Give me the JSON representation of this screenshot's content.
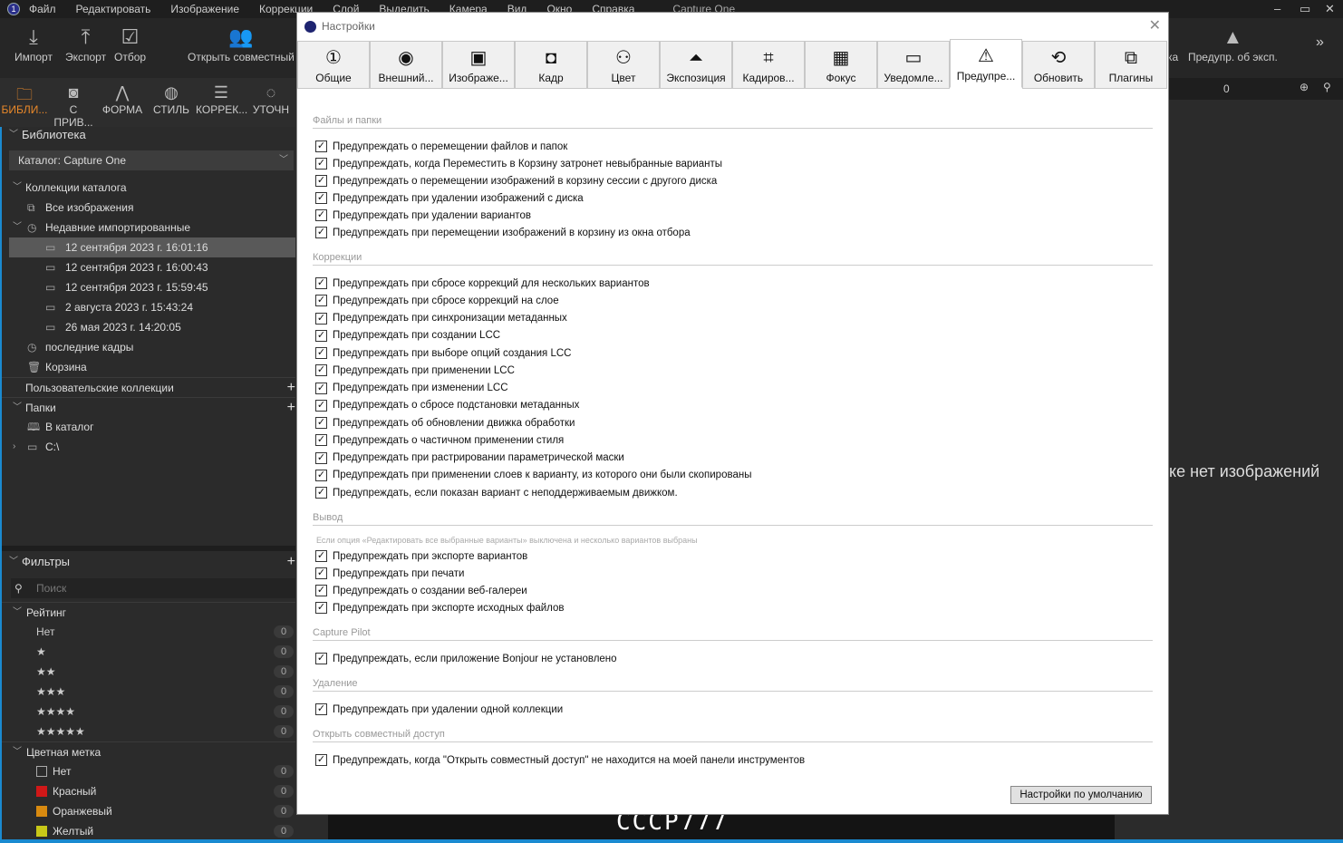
{
  "menu": {
    "items": [
      "Файл",
      "Редактировать",
      "Изображение",
      "Коррекции",
      "Слой",
      "Выделить",
      "Камера",
      "Вид",
      "Окно",
      "Справка"
    ],
    "app_title": "Capture One"
  },
  "toolbar": {
    "import": "Импорт",
    "export": "Экспорт",
    "select": "Отбор",
    "share": "Открыть совместный",
    "warn_partial": "ка",
    "exposure_warning": "Предупр. об эксп.",
    "counter": "0"
  },
  "tooltabs": [
    "БИБЛИ...",
    "С ПРИВ...",
    "ФОРМА",
    "СТИЛЬ",
    "КОРРЕК...",
    "УТОЧН"
  ],
  "library": {
    "title": "Библиотека",
    "catalog": "Каталог: Capture One",
    "collections": "Коллекции каталога",
    "all_images": "Все изображения",
    "recent_imports": "Недавние импортированные",
    "imports": [
      "12 сентября 2023 г. 16:01:16",
      "12 сентября 2023 г. 16:00:43",
      "12 сентября 2023 г. 15:59:45",
      "2 августа 2023 г. 15:43:24",
      "26 мая 2023 г. 14:20:05"
    ],
    "recent_captures": "последние кадры",
    "trash": "Корзина",
    "user_collections": "Пользовательские коллекции",
    "folders": "Папки",
    "in_catalog": "В каталог",
    "drive": "C:\\"
  },
  "filters": {
    "title": "Фильтры",
    "search_placeholder": "Поиск",
    "rating": "Рейтинг",
    "rating_rows": [
      {
        "label": "Нет",
        "count": "0"
      },
      {
        "label": "★",
        "count": "0"
      },
      {
        "label": "★★",
        "count": "0"
      },
      {
        "label": "★★★",
        "count": "0"
      },
      {
        "label": "★★★★",
        "count": "0"
      },
      {
        "label": "★★★★★",
        "count": "0"
      }
    ],
    "color_label": "Цветная метка",
    "colors": [
      {
        "label": "Нет",
        "count": "0",
        "color": "transparent"
      },
      {
        "label": "Красный",
        "count": "0",
        "color": "#d01818"
      },
      {
        "label": "Оранжевый",
        "count": "0",
        "color": "#d88a10"
      },
      {
        "label": "Желтый",
        "count": "0",
        "color": "#c8c818"
      }
    ]
  },
  "viewer": {
    "empty_text": "ке нет изображений",
    "logo": "CCCP777"
  },
  "dialog": {
    "title": "Настройки",
    "tabs": [
      {
        "label": "Общие",
        "icon": "①"
      },
      {
        "label": "Внешний...",
        "icon": "◉"
      },
      {
        "label": "Изображе...",
        "icon": "▣"
      },
      {
        "label": "Кадр",
        "icon": "◘"
      },
      {
        "label": "Цвет",
        "icon": "⚇"
      },
      {
        "label": "Экспозиция",
        "icon": "⏶"
      },
      {
        "label": "Кадиров...",
        "icon": "⌗"
      },
      {
        "label": "Фокус",
        "icon": "▦"
      },
      {
        "label": "Уведомле...",
        "icon": "▭"
      },
      {
        "label": "Предупре...",
        "icon": "⚠"
      },
      {
        "label": "Обновить",
        "icon": "⟲"
      },
      {
        "label": "Плагины",
        "icon": "⧉"
      }
    ],
    "sections": [
      {
        "title": "Файлы и папки",
        "items": [
          "Предупреждать о перемещении файлов и папок",
          "Предупреждать, когда Переместить в Корзину затронет невыбранные варианты",
          "Предупреждать о перемещении изображений в корзину сессии с другого диска",
          "Предупреждать при удалении изображений с диска",
          "Предупреждать при удалении вариантов",
          "Предупреждать при перемещении изображений в корзину из окна отбора"
        ]
      },
      {
        "title": "Коррекции",
        "items": [
          "Предупреждать при сбросе коррекций для нескольких вариантов",
          "Предупреждать при сбросе коррекций на слое",
          "Предупреждать при синхронизации метаданных",
          "Предупреждать при создании LCC",
          "Предупреждать при выборе опций создания LCC",
          "Предупреждать при применении LCC",
          "Предупреждать при изменении LCC",
          "Предупреждать о сбросе подстановки метаданных",
          "Предупреждать об обновлении движка обработки",
          "Предупреждать о частичном применении стиля",
          "Предупреждать при растрировании параметрической маски",
          "Предупреждать при применении слоев к варианту, из которого они были скопированы",
          "Предупреждать, если показан вариант с неподдерживаемым движком."
        ]
      },
      {
        "title": "Вывод",
        "note": "Если опция «Редактировать все выбранные варианты» выключена и несколько вариантов выбраны",
        "items": [
          "Предупреждать при экспорте вариантов",
          "Предупреждать при печати",
          "Предупреждать о создании веб-галереи",
          "Предупреждать при экспорте исходных файлов"
        ]
      },
      {
        "title": "Capture Pilot",
        "items": [
          "Предупреждать, если приложение Bonjour не установлено"
        ]
      },
      {
        "title": "Удаление",
        "items": [
          "Предупреждать при удалении одной коллекции"
        ]
      },
      {
        "title": "Открыть совместный доступ",
        "items": [
          "Предупреждать, когда \"Открыть совместный доступ\" не находится на моей панели инструментов"
        ]
      }
    ],
    "default_button": "Настройки по умолчанию"
  }
}
